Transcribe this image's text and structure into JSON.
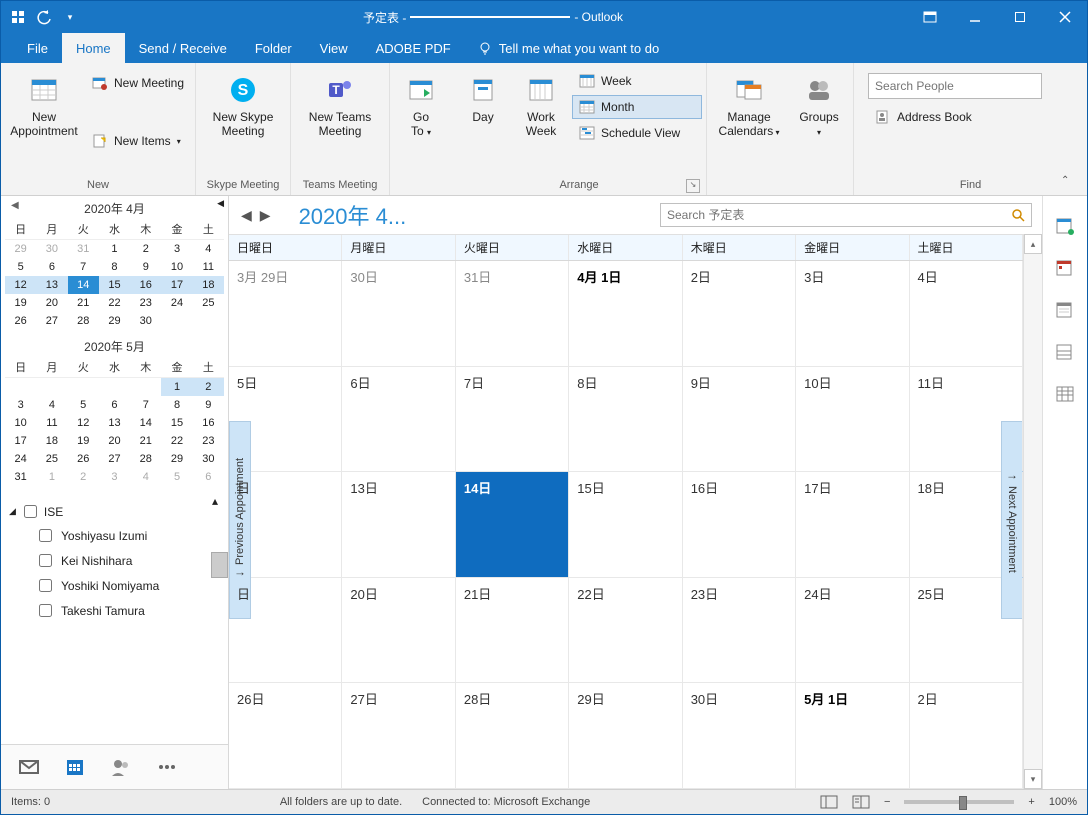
{
  "titlebar": {
    "app_prefix": "予定表 -",
    "account": "",
    "app_suffix": "- Outlook"
  },
  "tabs": {
    "file": "File",
    "home": "Home",
    "send_receive": "Send / Receive",
    "folder": "Folder",
    "view": "View",
    "adobe_pdf": "ADOBE PDF",
    "tell_me": "Tell me what you want to do"
  },
  "ribbon": {
    "groups": {
      "new": "New",
      "skype": "Skype Meeting",
      "teams": "Teams Meeting",
      "arrange": "Arrange",
      "find": "Find"
    },
    "new_appointment": "New\nAppointment",
    "new_meeting": "New Meeting",
    "new_items": "New Items",
    "new_skype": "New Skype\nMeeting",
    "new_teams": "New Teams\nMeeting",
    "go_to": "Go\nTo",
    "day": "Day",
    "work_week": "Work\nWeek",
    "week": "Week",
    "month": "Month",
    "schedule_view": "Schedule View",
    "manage_calendars": "Manage\nCalendars",
    "groups_btn": "Groups",
    "search_people_ph": "Search People",
    "address_book": "Address Book"
  },
  "sidebar": {
    "month1": {
      "title": "2020年 4月",
      "dow": [
        "日",
        "月",
        "火",
        "水",
        "木",
        "金",
        "土"
      ],
      "weeks": [
        [
          {
            "d": "29",
            "dim": true
          },
          {
            "d": "30",
            "dim": true
          },
          {
            "d": "31",
            "dim": true
          },
          {
            "d": "1"
          },
          {
            "d": "2"
          },
          {
            "d": "3"
          },
          {
            "d": "4"
          }
        ],
        [
          {
            "d": "5"
          },
          {
            "d": "6"
          },
          {
            "d": "7"
          },
          {
            "d": "8"
          },
          {
            "d": "9"
          },
          {
            "d": "10"
          },
          {
            "d": "11"
          }
        ],
        [
          {
            "d": "12",
            "sel": true
          },
          {
            "d": "13",
            "sel": true
          },
          {
            "d": "14",
            "sel": true,
            "today": true
          },
          {
            "d": "15",
            "sel": true
          },
          {
            "d": "16",
            "sel": true
          },
          {
            "d": "17",
            "sel": true
          },
          {
            "d": "18",
            "sel": true
          }
        ],
        [
          {
            "d": "19"
          },
          {
            "d": "20"
          },
          {
            "d": "21"
          },
          {
            "d": "22"
          },
          {
            "d": "23"
          },
          {
            "d": "24"
          },
          {
            "d": "25"
          }
        ],
        [
          {
            "d": "26"
          },
          {
            "d": "27"
          },
          {
            "d": "28"
          },
          {
            "d": "29"
          },
          {
            "d": "30"
          },
          {
            "d": ""
          },
          {
            "d": ""
          }
        ]
      ]
    },
    "month2": {
      "title": "2020年 5月",
      "dow": [
        "日",
        "月",
        "火",
        "水",
        "木",
        "金",
        "土"
      ],
      "weeks": [
        [
          {
            "d": ""
          },
          {
            "d": ""
          },
          {
            "d": ""
          },
          {
            "d": ""
          },
          {
            "d": ""
          },
          {
            "d": "1",
            "sel": true
          },
          {
            "d": "2",
            "sel": true
          }
        ],
        [
          {
            "d": "3"
          },
          {
            "d": "4"
          },
          {
            "d": "5"
          },
          {
            "d": "6"
          },
          {
            "d": "7"
          },
          {
            "d": "8"
          },
          {
            "d": "9"
          }
        ],
        [
          {
            "d": "10"
          },
          {
            "d": "11"
          },
          {
            "d": "12"
          },
          {
            "d": "13"
          },
          {
            "d": "14"
          },
          {
            "d": "15"
          },
          {
            "d": "16"
          }
        ],
        [
          {
            "d": "17"
          },
          {
            "d": "18"
          },
          {
            "d": "19"
          },
          {
            "d": "20"
          },
          {
            "d": "21"
          },
          {
            "d": "22"
          },
          {
            "d": "23"
          }
        ],
        [
          {
            "d": "24"
          },
          {
            "d": "25"
          },
          {
            "d": "26"
          },
          {
            "d": "27"
          },
          {
            "d": "28"
          },
          {
            "d": "29"
          },
          {
            "d": "30"
          }
        ],
        [
          {
            "d": "31"
          },
          {
            "d": "1",
            "dim": true
          },
          {
            "d": "2",
            "dim": true
          },
          {
            "d": "3",
            "dim": true
          },
          {
            "d": "4",
            "dim": true
          },
          {
            "d": "5",
            "dim": true
          },
          {
            "d": "6",
            "dim": true
          }
        ]
      ]
    },
    "cal_group": "ISE",
    "calendars": [
      "Yoshiyasu Izumi",
      "Kei Nishihara",
      "Yoshiki Nomiyama",
      "Takeshi Tamura"
    ]
  },
  "calendar": {
    "title": "2020年 4...",
    "search_ph": "Search 予定表",
    "dow": [
      "日曜日",
      "月曜日",
      "火曜日",
      "水曜日",
      "木曜日",
      "金曜日",
      "土曜日"
    ],
    "prev_appt": "Previous Appointment",
    "next_appt": "Next Appointment",
    "weeks": [
      [
        {
          "t": "3月 29日",
          "dim": true
        },
        {
          "t": "30日",
          "dim": true
        },
        {
          "t": "31日",
          "dim": true
        },
        {
          "t": "4月 1日",
          "bold": true
        },
        {
          "t": "2日"
        },
        {
          "t": "3日"
        },
        {
          "t": "4日"
        }
      ],
      [
        {
          "t": "5日"
        },
        {
          "t": "6日"
        },
        {
          "t": "7日"
        },
        {
          "t": "8日"
        },
        {
          "t": "9日"
        },
        {
          "t": "10日"
        },
        {
          "t": "11日"
        }
      ],
      [
        {
          "t": "日"
        },
        {
          "t": "13日"
        },
        {
          "t": "14日",
          "today": true
        },
        {
          "t": "15日"
        },
        {
          "t": "16日"
        },
        {
          "t": "17日"
        },
        {
          "t": "18日"
        }
      ],
      [
        {
          "t": "日"
        },
        {
          "t": "20日"
        },
        {
          "t": "21日"
        },
        {
          "t": "22日"
        },
        {
          "t": "23日"
        },
        {
          "t": "24日"
        },
        {
          "t": "25日"
        }
      ],
      [
        {
          "t": "26日"
        },
        {
          "t": "27日"
        },
        {
          "t": "28日"
        },
        {
          "t": "29日"
        },
        {
          "t": "30日"
        },
        {
          "t": "5月 1日",
          "bold": true
        },
        {
          "t": "2日"
        }
      ]
    ]
  },
  "status": {
    "items": "Items: 0",
    "sync": "All folders are up to date.",
    "conn": "Connected to: Microsoft Exchange",
    "zoom": "100%"
  }
}
